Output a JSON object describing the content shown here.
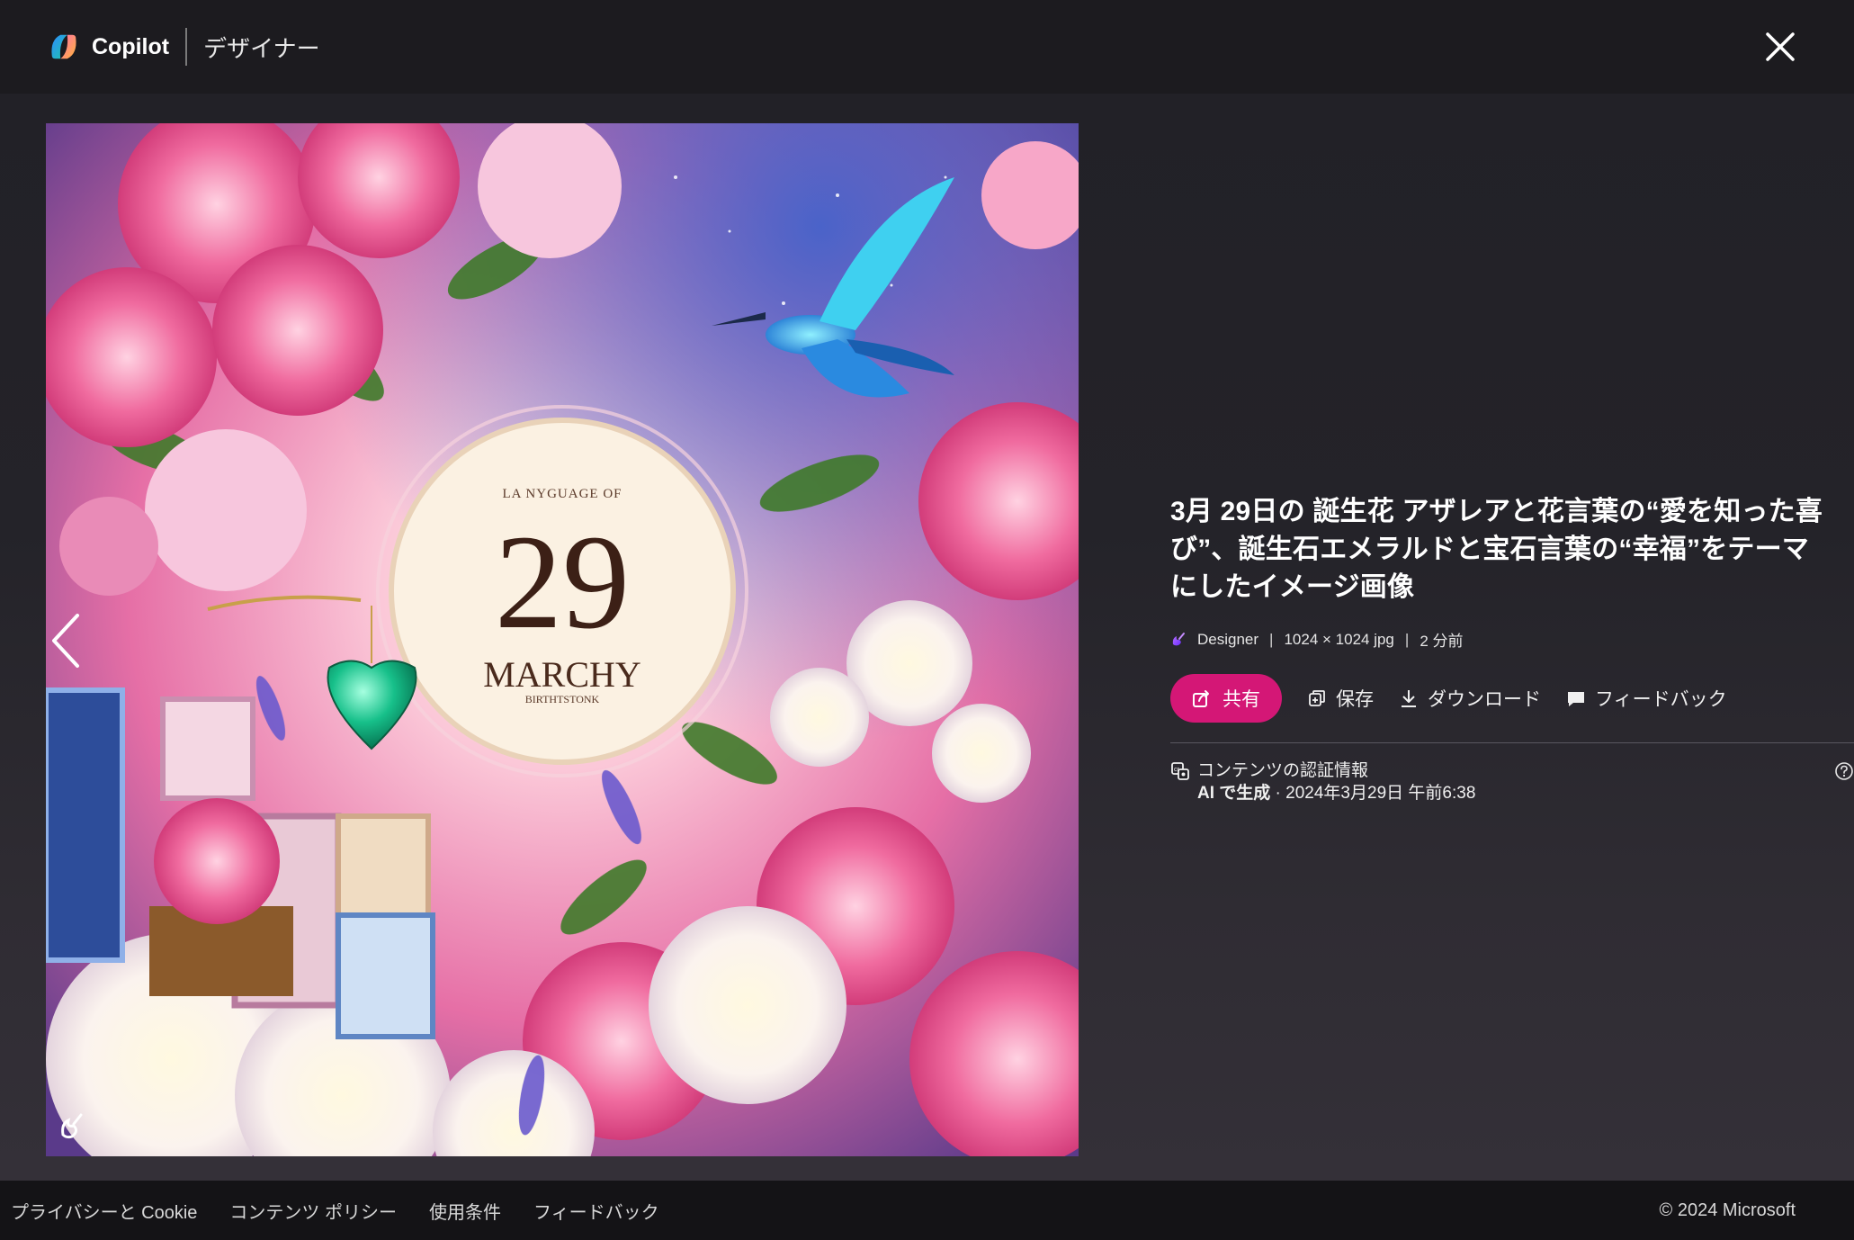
{
  "header": {
    "brand": "Copilot",
    "subtitle": "デザイナー"
  },
  "artwork": {
    "small_line": "LA NYGUAGE OF",
    "number": "29",
    "month": "MARCHY",
    "bottom_line": "BIRTHTSTONK"
  },
  "details": {
    "title": "3月 29日の 誕生花 アザレアと花言葉の“愛を知った喜び”、誕生石エメラルドと宝石言葉の“幸福”をテーマにしたイメージ画像",
    "meta": {
      "source": "Designer",
      "separator": "|",
      "size": "1024 × 1024 jpg",
      "time": "2 分前"
    },
    "actions": {
      "share": "共有",
      "save": "保存",
      "download": "ダウンロード",
      "feedback": "フィードバック"
    },
    "credentials": {
      "title": "コンテンツの認証情報",
      "ai_label": "AI で生成",
      "date": " · 2024年3月29日 午前6:38"
    }
  },
  "footer": {
    "links": [
      "プライバシーと Cookie",
      "コンテンツ ポリシー",
      "使用条件",
      "フィードバック"
    ],
    "copyright": "© 2024 Microsoft"
  },
  "colors": {
    "accent": "#d41776",
    "background": "#1c1b1f"
  }
}
